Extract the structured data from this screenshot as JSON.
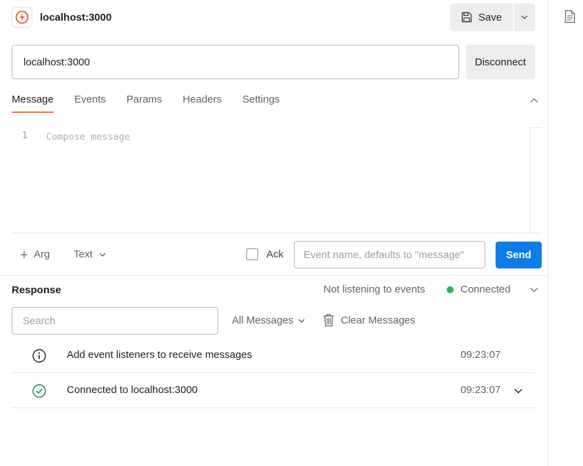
{
  "header": {
    "title": "localhost:3000",
    "app_icon": "socketio-icon",
    "save_label": "Save"
  },
  "connection": {
    "url_value": "localhost:3000",
    "disconnect_label": "Disconnect"
  },
  "tabs": [
    {
      "label": "Message",
      "active": true
    },
    {
      "label": "Events",
      "active": false
    },
    {
      "label": "Params",
      "active": false
    },
    {
      "label": "Headers",
      "active": false
    },
    {
      "label": "Settings",
      "active": false
    }
  ],
  "editor": {
    "line_number": "1",
    "placeholder": "Compose message"
  },
  "message_controls": {
    "arg_label": "Arg",
    "type_label": "Text",
    "ack_label": "Ack",
    "ack_checked": false,
    "event_placeholder": "Event name, defaults to \"message\"",
    "send_label": "Send"
  },
  "response": {
    "title": "Response",
    "listen_status": "Not listening to events",
    "connection_status": "Connected",
    "search_placeholder": "Search",
    "filter_label": "All Messages",
    "clear_label": "Clear Messages",
    "messages": [
      {
        "icon": "info-icon",
        "text": "Add event listeners to receive messages",
        "time": "09:23:07"
      },
      {
        "icon": "check-circle-icon",
        "text": "Connected to localhost:3000",
        "time": "09:23:07"
      }
    ]
  },
  "colors": {
    "accent": "#ff6c37",
    "primary_button": "#0f7de8",
    "connected": "#1db954",
    "success_icon": "#0a8a3a"
  }
}
